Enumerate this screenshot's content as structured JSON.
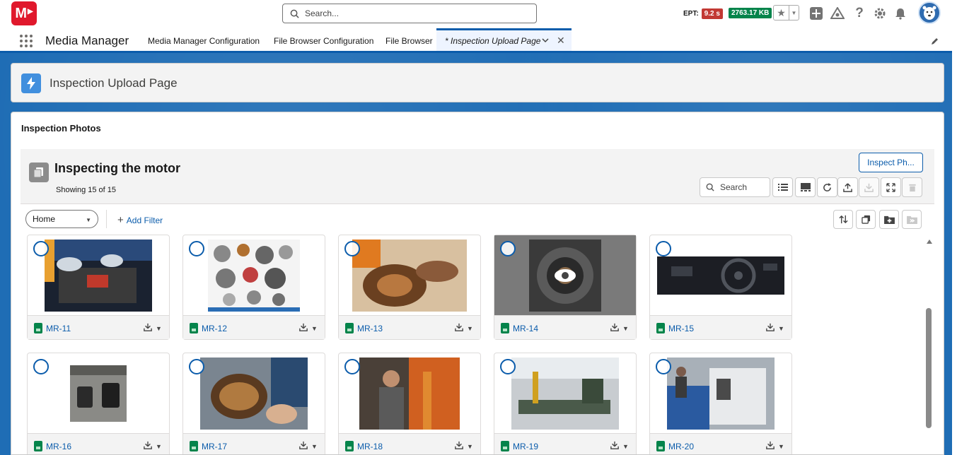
{
  "global_header": {
    "logo_text": "M",
    "search_placeholder": "Search...",
    "ept_label": "EPT:",
    "ept_value": "9.2 s",
    "size_value": "2763.17 KB",
    "icons": [
      "favorite-star-icon",
      "add-icon",
      "trailhead-icon",
      "help-icon",
      "setup-gear-icon",
      "notifications-bell-icon",
      "user-avatar-icon"
    ]
  },
  "nav": {
    "app_name": "Media Manager",
    "items": [
      {
        "label": "Media Manager Configuration"
      },
      {
        "label": "File Browser Configuration"
      },
      {
        "label": "File Browser"
      }
    ],
    "active_tab": "* Inspection Upload Page"
  },
  "page_header": {
    "title": "Inspection Upload Page"
  },
  "card": {
    "title": "Inspection Photos",
    "library_title": "Inspecting the motor",
    "showing": "Showing 15 of 15",
    "inspect_button": "Inspect Ph...",
    "search_placeholder": "Search",
    "filter_select": "Home",
    "add_filter": "Add Filter"
  },
  "tiles": [
    {
      "name": "MR-11"
    },
    {
      "name": "MR-12"
    },
    {
      "name": "MR-13"
    },
    {
      "name": "MR-14"
    },
    {
      "name": "MR-15"
    },
    {
      "name": "MR-16"
    },
    {
      "name": "MR-17"
    },
    {
      "name": "MR-18"
    },
    {
      "name": "MR-19"
    },
    {
      "name": "MR-20"
    }
  ],
  "colors": {
    "brand_blue": "#0b5cab",
    "logo_red": "#e0182c",
    "ept_red": "#c23934",
    "size_green": "#04844b"
  }
}
